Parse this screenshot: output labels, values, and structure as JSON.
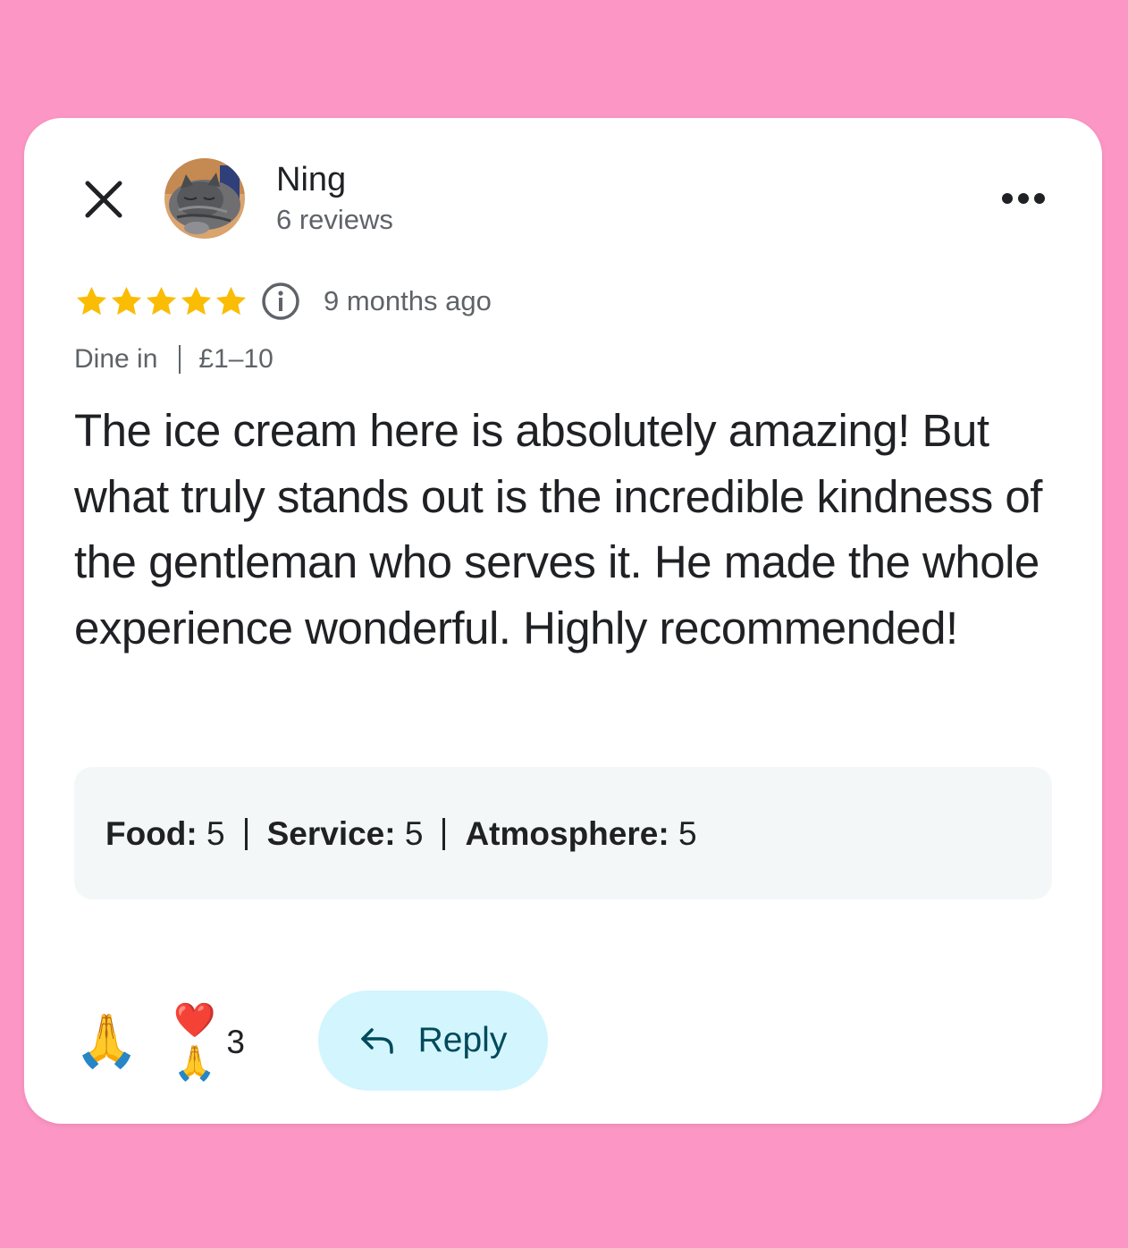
{
  "review": {
    "reviewer_name": "Ning",
    "reviewer_meta": "6 reviews",
    "rating": 5,
    "time_ago": "9 months ago",
    "meta": {
      "mode": "Dine in",
      "price": "£1–10"
    },
    "text": "The ice cream here is absolutely amazing! But what truly stands out is the incredible kindness of the gentleman who serves it. He made the whole experience wonderful. Highly recommended!",
    "scores": [
      {
        "label": "Food:",
        "value": "5"
      },
      {
        "label": "Service:",
        "value": "5"
      },
      {
        "label": "Atmosphere:",
        "value": "5"
      }
    ]
  },
  "actions": {
    "react_emoji": "🙏",
    "reactions_emoji": "❤️🙏",
    "reaction_count": "3",
    "reply_label": "Reply"
  },
  "icons": {
    "close": "close-icon",
    "more": "more-dots-icon",
    "info": "info-icon",
    "reply": "reply-arrow-icon",
    "star": "star-icon"
  },
  "colors": {
    "background": "#fc96c4",
    "card": "#ffffff",
    "star": "#fbbc04",
    "reply_bg": "#d3f5fd",
    "reply_text": "#004a5a",
    "scores_bg": "#f4f7f8"
  }
}
